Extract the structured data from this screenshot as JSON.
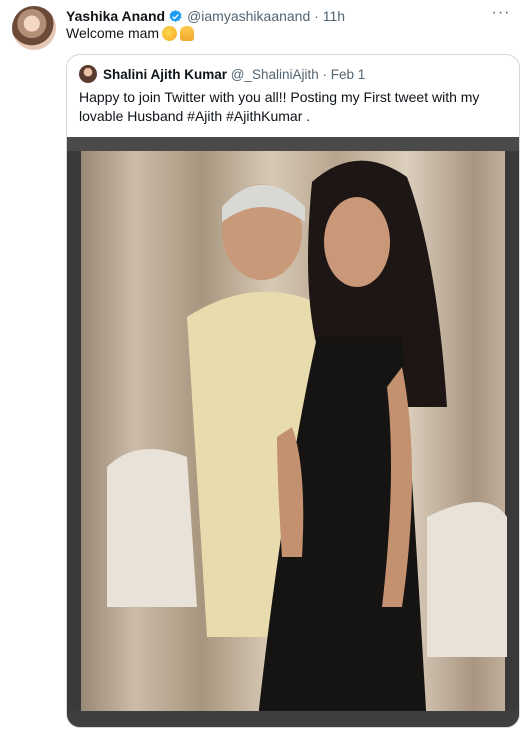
{
  "tweet": {
    "display_name": "Yashika Anand",
    "handle": "@iamyashikaanand",
    "time": "11h",
    "text": "Welcome mam",
    "emojis": [
      "smiling-face-with-hearts",
      "folded-hands"
    ],
    "more_icon": "ellipsis-icon",
    "verified_color": "#1d9bf0"
  },
  "quoted_tweet": {
    "display_name": "Shalini Ajith Kumar",
    "handle": "@_ShaliniAjith",
    "date": "Feb 1",
    "text_line1": "Happy to join Twitter with you all!! Posting my First tweet with my",
    "text_line2": "lovable Husband #Ajith #AjithKumar ."
  }
}
